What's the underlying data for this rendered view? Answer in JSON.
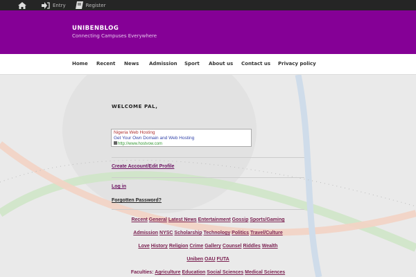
{
  "topbar": {
    "entry": "Entry",
    "register": "Register"
  },
  "header": {
    "title": "UNIBENBLOG",
    "tagline": "Connecting Campuses Everywhere"
  },
  "nav": [
    "Home",
    "Recent",
    "News",
    "Admission",
    "Sport",
    "About us",
    "Contact us",
    "Privacy policy"
  ],
  "main": {
    "welcome": "WELCOME PAL,",
    "ad": {
      "line1": "Nigeria Web Hosting",
      "line2": "Get Your Own Domain and Web Hosting",
      "url": "http://www.hostvow.com"
    },
    "create_account": "Create Account/Edit Profile",
    "login": "Log in",
    "forgot": "Forgotten Password?"
  },
  "categories": [
    [
      "Recent",
      "General",
      "Latest News",
      "Entertainment",
      "Gossip",
      "Sports/Gaming"
    ],
    [
      "Admission",
      "NYSC",
      "Scholarship",
      "Technology",
      "Politics",
      "Travel/Culture"
    ],
    [
      "Love",
      "History",
      "Religion",
      "Crime",
      "Gallery",
      "Counsel",
      "Riddles",
      "Wealth"
    ],
    [
      "Uniben",
      "OAU",
      "FUTA"
    ]
  ],
  "faculties": {
    "label": "Faculties:",
    "items": [
      "Agriculture",
      "Education",
      "Social Sciences",
      "Medical Sciences"
    ]
  },
  "colors": {
    "header": "#850096",
    "topbar": "#252525",
    "link": "#7a2050"
  }
}
